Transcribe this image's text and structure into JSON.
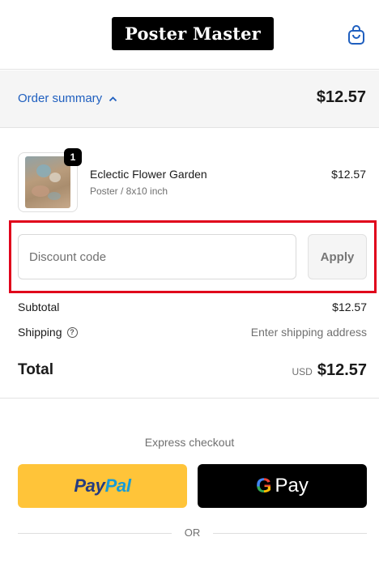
{
  "header": {
    "logo_text": "Poster Master",
    "cart_icon": "shopping-bag-icon"
  },
  "summary": {
    "toggle_label": "Order summary",
    "toggle_icon": "chevron-up-icon",
    "total": "$12.57"
  },
  "product": {
    "name": "Eclectic Flower Garden",
    "variant": "Poster / 8x10 inch",
    "price": "$12.57",
    "quantity": "1"
  },
  "discount": {
    "placeholder": "Discount code",
    "apply_label": "Apply"
  },
  "totals": {
    "subtotal_label": "Subtotal",
    "subtotal_value": "$12.57",
    "shipping_label": "Shipping",
    "shipping_value": "Enter shipping address",
    "total_label": "Total",
    "currency": "USD",
    "total_value": "$12.57"
  },
  "express": {
    "heading": "Express checkout",
    "paypal_part1": "Pay",
    "paypal_part2": "Pal",
    "gpay_g": "G",
    "gpay_label": "Pay",
    "or_label": "OR"
  },
  "colors": {
    "accent_link": "#1f5fbf",
    "highlight_border": "#e0001b",
    "paypal_bg": "#ffc439"
  }
}
